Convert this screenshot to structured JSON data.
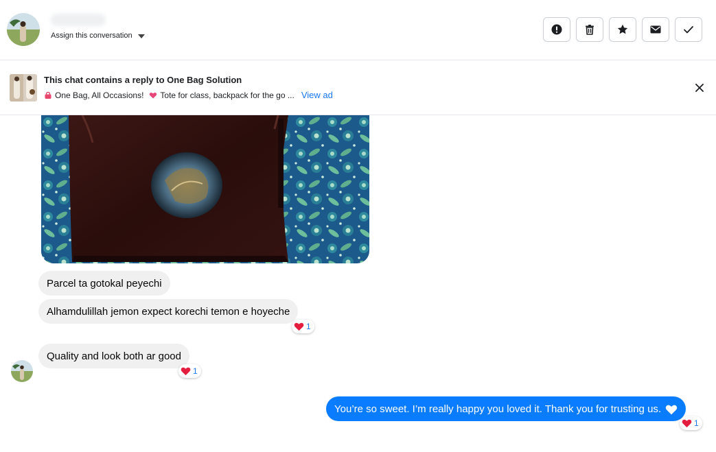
{
  "header": {
    "assign_label": "Assign this conversation",
    "actions": [
      {
        "name": "report",
        "icon": "alert-icon"
      },
      {
        "name": "delete",
        "icon": "trash-icon"
      },
      {
        "name": "star",
        "icon": "star-icon"
      },
      {
        "name": "mark-unread",
        "icon": "envelope-icon"
      },
      {
        "name": "mark-done",
        "icon": "check-icon"
      }
    ]
  },
  "banner": {
    "title": "This chat contains a reply to One Bag Solution",
    "subtitle_part1": "One Bag, All Occasions!",
    "subtitle_part2": "Tote for class, backpack for the go ...",
    "view_ad": "View ad"
  },
  "messages": [
    {
      "direction": "in",
      "text": "Parcel ta gotokal peyechi"
    },
    {
      "direction": "in",
      "text": "Alhamdulillah jemon expect korechi temon e hoyeche",
      "reaction_count": "1"
    },
    {
      "direction": "in",
      "text": "Quality and look both ar good",
      "reaction_count": "1"
    },
    {
      "direction": "out",
      "text": "You’re so sweet. I’m really happy you loved it. Thank you for trusting us.",
      "reaction_count": "1"
    }
  ],
  "colors": {
    "accent": "#1877f2",
    "outgoing_bubble": "#0a7cff",
    "incoming_bubble": "#f0f0f0",
    "heart": "#e41e3f"
  }
}
